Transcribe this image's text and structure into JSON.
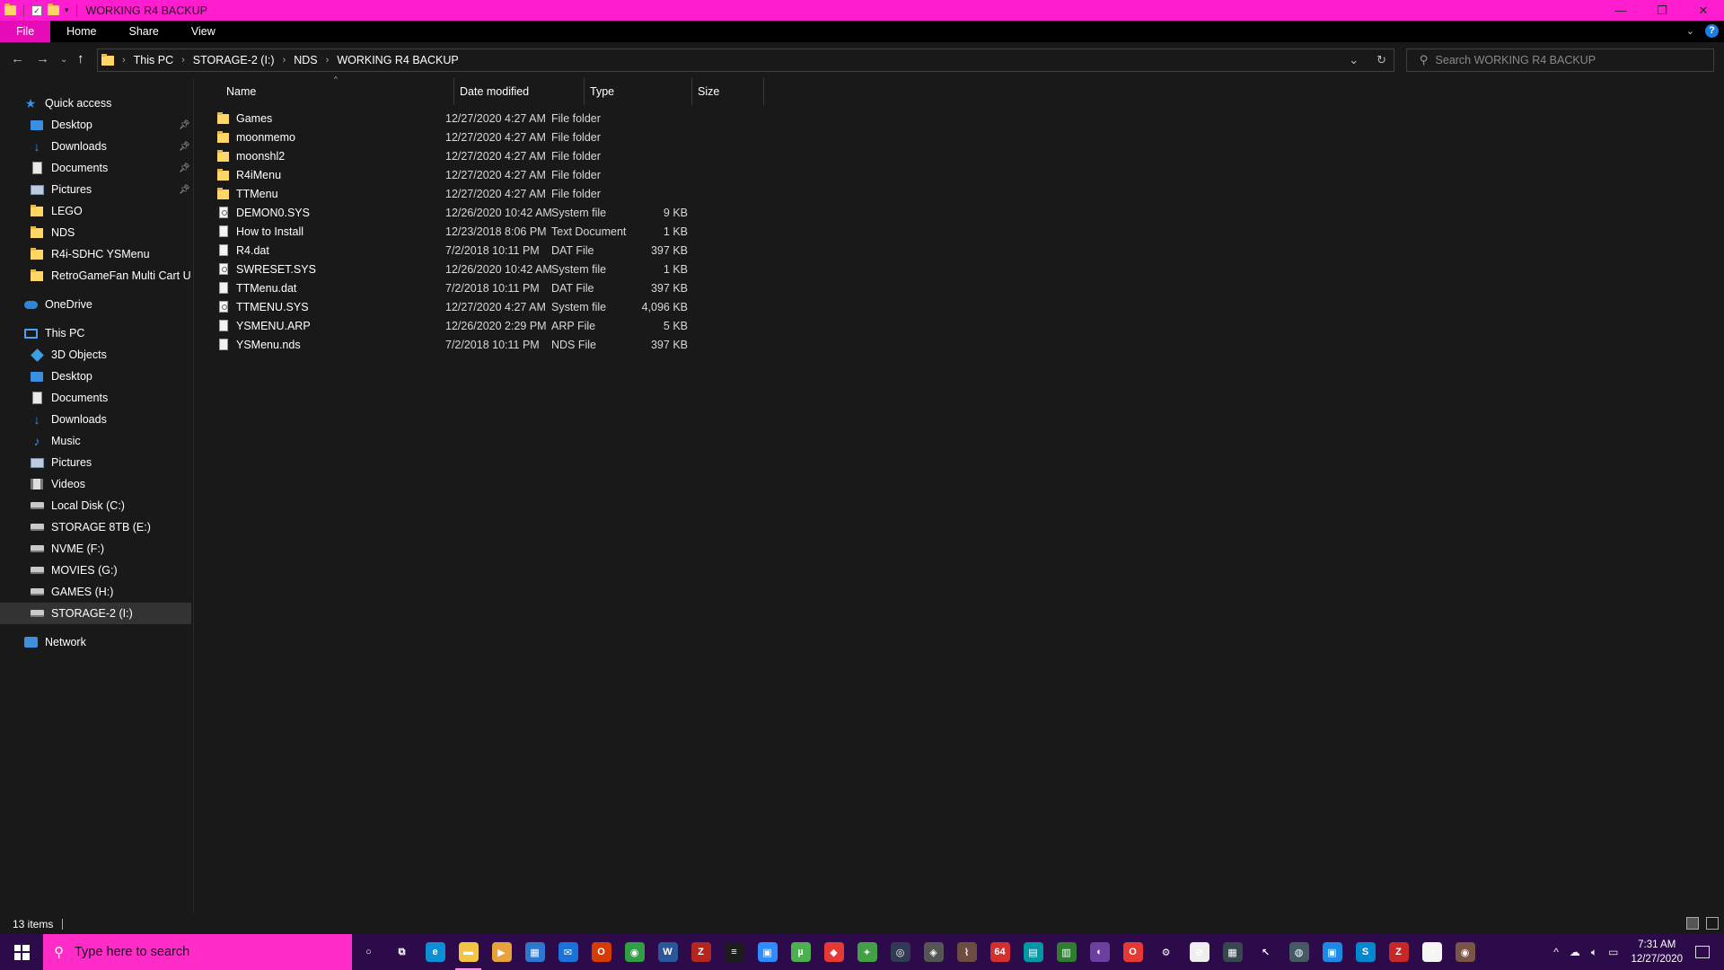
{
  "window": {
    "title": "WORKING R4 BACKUP",
    "controls": {
      "minimize": "—",
      "restore": "❐",
      "close": "✕"
    }
  },
  "ribbon": {
    "tabs": [
      "File",
      "Home",
      "Share",
      "View"
    ],
    "expand_icon": "chevron-down-icon",
    "help_label": "?"
  },
  "address": {
    "crumbs": [
      "This PC",
      "STORAGE-2 (I:)",
      "NDS",
      "WORKING R4 BACKUP"
    ],
    "search_placeholder": "Search WORKING R4 BACKUP"
  },
  "sidebar": {
    "quick_access": {
      "label": "Quick access",
      "items": [
        {
          "label": "Desktop",
          "icon": "desktop-icon",
          "pinned": true
        },
        {
          "label": "Downloads",
          "icon": "downloads-icon",
          "pinned": true
        },
        {
          "label": "Documents",
          "icon": "documents-icon",
          "pinned": true
        },
        {
          "label": "Pictures",
          "icon": "pictures-icon",
          "pinned": true
        },
        {
          "label": "LEGO",
          "icon": "folder-icon",
          "pinned": false
        },
        {
          "label": "NDS",
          "icon": "folder-icon",
          "pinned": false
        },
        {
          "label": "R4i-SDHC YSMenu",
          "icon": "folder-icon",
          "pinned": false
        },
        {
          "label": "RetroGameFan Multi Cart Upda",
          "icon": "folder-icon",
          "pinned": false
        }
      ]
    },
    "onedrive": {
      "label": "OneDrive"
    },
    "this_pc": {
      "label": "This PC",
      "items": [
        {
          "label": "3D Objects",
          "icon": "3d-objects-icon"
        },
        {
          "label": "Desktop",
          "icon": "desktop-icon"
        },
        {
          "label": "Documents",
          "icon": "documents-icon"
        },
        {
          "label": "Downloads",
          "icon": "downloads-icon"
        },
        {
          "label": "Music",
          "icon": "music-icon"
        },
        {
          "label": "Pictures",
          "icon": "pictures-icon"
        },
        {
          "label": "Videos",
          "icon": "videos-icon"
        },
        {
          "label": "Local Disk (C:)",
          "icon": "drive-icon"
        },
        {
          "label": "STORAGE 8TB (E:)",
          "icon": "drive-icon"
        },
        {
          "label": "NVME (F:)",
          "icon": "drive-icon"
        },
        {
          "label": "MOVIES (G:)",
          "icon": "drive-icon"
        },
        {
          "label": "GAMES (H:)",
          "icon": "drive-icon"
        },
        {
          "label": "STORAGE-2 (I:)",
          "icon": "drive-icon",
          "selected": true
        }
      ]
    },
    "network": {
      "label": "Network"
    }
  },
  "files": {
    "columns": {
      "name": "Name",
      "date": "Date modified",
      "type": "Type",
      "size": "Size"
    },
    "rows": [
      {
        "name": "Games",
        "date": "12/27/2020 4:27 AM",
        "type": "File folder",
        "size": "",
        "kind": "folder"
      },
      {
        "name": "moonmemo",
        "date": "12/27/2020 4:27 AM",
        "type": "File folder",
        "size": "",
        "kind": "folder"
      },
      {
        "name": "moonshl2",
        "date": "12/27/2020 4:27 AM",
        "type": "File folder",
        "size": "",
        "kind": "folder"
      },
      {
        "name": "R4iMenu",
        "date": "12/27/2020 4:27 AM",
        "type": "File folder",
        "size": "",
        "kind": "folder"
      },
      {
        "name": "TTMenu",
        "date": "12/27/2020 4:27 AM",
        "type": "File folder",
        "size": "",
        "kind": "folder"
      },
      {
        "name": "DEMON0.SYS",
        "date": "12/26/2020 10:42 AM",
        "type": "System file",
        "size": "9 KB",
        "kind": "sys"
      },
      {
        "name": "How to Install",
        "date": "12/23/2018 8:06 PM",
        "type": "Text Document",
        "size": "1 KB",
        "kind": "file"
      },
      {
        "name": "R4.dat",
        "date": "7/2/2018 10:11 PM",
        "type": "DAT File",
        "size": "397 KB",
        "kind": "file"
      },
      {
        "name": "SWRESET.SYS",
        "date": "12/26/2020 10:42 AM",
        "type": "System file",
        "size": "1 KB",
        "kind": "sys"
      },
      {
        "name": "TTMenu.dat",
        "date": "7/2/2018 10:11 PM",
        "type": "DAT File",
        "size": "397 KB",
        "kind": "file"
      },
      {
        "name": "TTMENU.SYS",
        "date": "12/27/2020 4:27 AM",
        "type": "System file",
        "size": "4,096 KB",
        "kind": "sys"
      },
      {
        "name": "YSMENU.ARP",
        "date": "12/26/2020 2:29 PM",
        "type": "ARP File",
        "size": "5 KB",
        "kind": "file"
      },
      {
        "name": "YSMenu.nds",
        "date": "7/2/2018 10:11 PM",
        "type": "NDS File",
        "size": "397 KB",
        "kind": "file"
      }
    ]
  },
  "status": {
    "item_count": "13 items"
  },
  "taskbar": {
    "search_placeholder": "Type here to search",
    "apps": [
      {
        "name": "cortana-icon",
        "glyph": "○",
        "color": "transparent"
      },
      {
        "name": "task-view-icon",
        "glyph": "⧉",
        "color": "transparent"
      },
      {
        "name": "edge-icon",
        "glyph": "e",
        "color": "#0c8fd6"
      },
      {
        "name": "file-explorer-icon",
        "glyph": "▬",
        "color": "#f4c542",
        "active": true
      },
      {
        "name": "media-player-icon",
        "glyph": "▶",
        "color": "#e9a23b"
      },
      {
        "name": "store-icon",
        "glyph": "▦",
        "color": "#2e77d0"
      },
      {
        "name": "mail-icon",
        "glyph": "✉",
        "color": "#1a73d9"
      },
      {
        "name": "office-icon",
        "glyph": "O",
        "color": "#d83b01"
      },
      {
        "name": "chrome-icon",
        "glyph": "◉",
        "color": "#2f9e44"
      },
      {
        "name": "word-icon",
        "glyph": "W",
        "color": "#2b579a"
      },
      {
        "name": "cpuz-icon",
        "glyph": "Z",
        "color": "#b3261e"
      },
      {
        "name": "ryzen-master-icon",
        "glyph": "≡",
        "color": "#1c1c1c"
      },
      {
        "name": "zoom-icon",
        "glyph": "▣",
        "color": "#2d8cff"
      },
      {
        "name": "utorrent-icon",
        "glyph": "µ",
        "color": "#4caf50"
      },
      {
        "name": "rubik-icon",
        "glyph": "◆",
        "color": "#e53935"
      },
      {
        "name": "download-manager-icon",
        "glyph": "✦",
        "color": "#43a047"
      },
      {
        "name": "obs-icon",
        "glyph": "◎",
        "color": "#303a52"
      },
      {
        "name": "gamepad-icon",
        "glyph": "◈",
        "color": "#555"
      },
      {
        "name": "audio-icon",
        "glyph": "⌇",
        "color": "#6d4c41"
      },
      {
        "name": "app-64-icon",
        "glyph": "64",
        "color": "#d32f2f"
      },
      {
        "name": "remote-icon",
        "glyph": "▤",
        "color": "#0097a7"
      },
      {
        "name": "hw-monitor-icon",
        "glyph": "▥",
        "color": "#2e7d32"
      },
      {
        "name": "tor-icon",
        "glyph": "◐",
        "color": "#6a3fa0"
      },
      {
        "name": "opera-icon",
        "glyph": "O",
        "color": "#e53935"
      },
      {
        "name": "settings-icon",
        "glyph": "⚙",
        "color": "transparent"
      },
      {
        "name": "block-icon",
        "glyph": "⊘",
        "color": "#eee"
      },
      {
        "name": "calc-icon",
        "glyph": "▦",
        "color": "#37474f"
      },
      {
        "name": "cursor-icon",
        "glyph": "↖",
        "color": "transparent"
      },
      {
        "name": "network-tool-icon",
        "glyph": "◍",
        "color": "#455a64"
      },
      {
        "name": "vm-icon",
        "glyph": "▣",
        "color": "#1e88e5"
      },
      {
        "name": "sync-icon",
        "glyph": "S",
        "color": "#0288d1"
      },
      {
        "name": "filezilla-icon",
        "glyph": "Z",
        "color": "#c62828"
      },
      {
        "name": "clock-app-icon",
        "glyph": "◔",
        "color": "#f5f5f5"
      },
      {
        "name": "disk-icon",
        "glyph": "◉",
        "color": "#795548"
      }
    ],
    "tray": {
      "chevron": "^",
      "time": "7:31 AM",
      "date": "12/27/2020"
    }
  }
}
